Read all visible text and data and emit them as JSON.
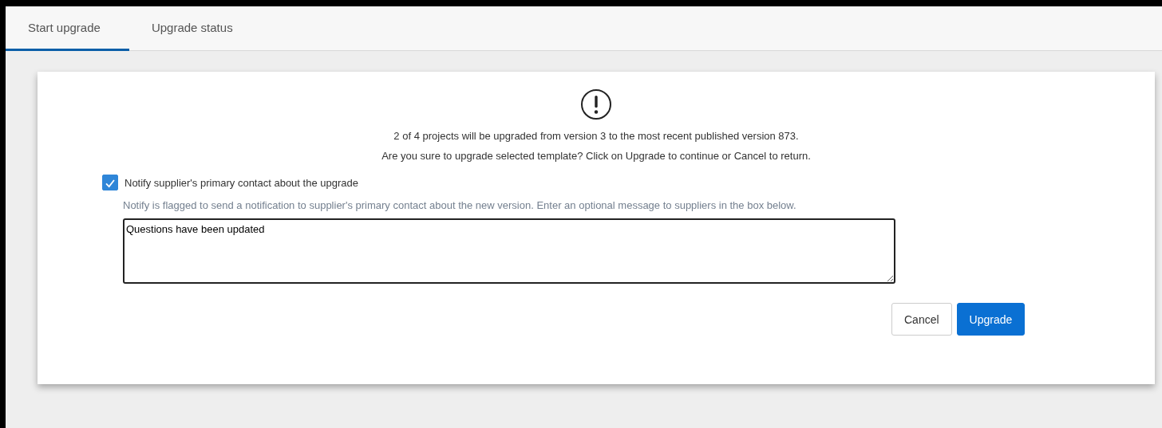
{
  "tabs": [
    {
      "label": "Start upgrade",
      "selected": true
    },
    {
      "label": "Upgrade status",
      "selected": false
    }
  ],
  "dialog": {
    "messages": [
      "2 of 4 projects will be upgraded from version 3 to the most recent published version 873.",
      "Are you sure to upgrade selected template? Click on Upgrade to continue or Cancel to return."
    ],
    "notify": {
      "label": "Notify supplier's primary contact about the upgrade",
      "checked": true
    },
    "hint": "Notify is flagged to send a notification to supplier's primary contact about the new version. Enter an optional message to suppliers in the box below.",
    "message": {
      "value": "Questions have been updated"
    },
    "buttons": [
      {
        "label": "Cancel",
        "kind": "secondary"
      },
      {
        "label": "Upgrade",
        "kind": "primary"
      }
    ]
  }
}
